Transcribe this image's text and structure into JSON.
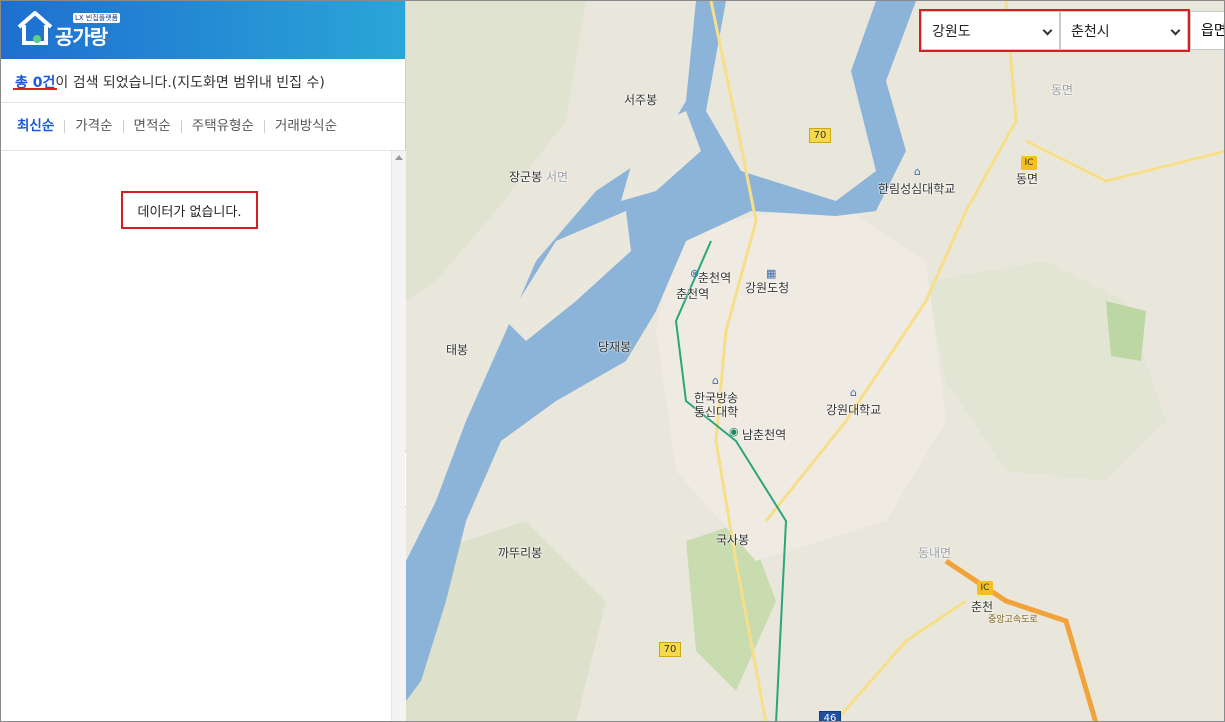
{
  "brand": {
    "logo_text": "공가랑",
    "logo_sub": "LX 빈집플랫폼"
  },
  "result": {
    "count_label": "총 0건",
    "count_suffix": "이 검색 되었습니다.(지도화면 범위내 빈집 수)"
  },
  "sort": {
    "items": [
      "최신순",
      "가격순",
      "면적순",
      "주택유형순",
      "거래방식순"
    ]
  },
  "list": {
    "empty_message": "데이터가 없습니다."
  },
  "filters": {
    "province": "강원도",
    "city": "춘천시",
    "town": "읍면"
  },
  "map": {
    "labels": [
      {
        "text": "서주봉"
      },
      {
        "text": "장군봉"
      },
      {
        "text": "태봉"
      },
      {
        "text": "당재봉"
      },
      {
        "text": "춘천역"
      },
      {
        "text": "춘천역"
      },
      {
        "text": "강원도청"
      },
      {
        "text": "한림성심대학교"
      },
      {
        "text": "동면"
      },
      {
        "text": "한국방송"
      },
      {
        "text": "통신대학"
      },
      {
        "text": "남춘천역"
      },
      {
        "text": "강원대학교"
      },
      {
        "text": "국사봉"
      },
      {
        "text": "까뚜리봉"
      },
      {
        "text": "동내면"
      },
      {
        "text": "춘천"
      },
      {
        "text": "중앙고속도로"
      },
      {
        "text": "동면"
      },
      {
        "text": "서면"
      }
    ],
    "road_badges": [
      "70",
      "70",
      "46"
    ],
    "ic_badges": [
      "IC",
      "IC"
    ]
  },
  "colors": {
    "brand": "#1e6fd0",
    "accent": "#1a5bd4",
    "highlight": "#d61f1f",
    "water": "#8cb3d8",
    "land": "#e9e7dc"
  }
}
